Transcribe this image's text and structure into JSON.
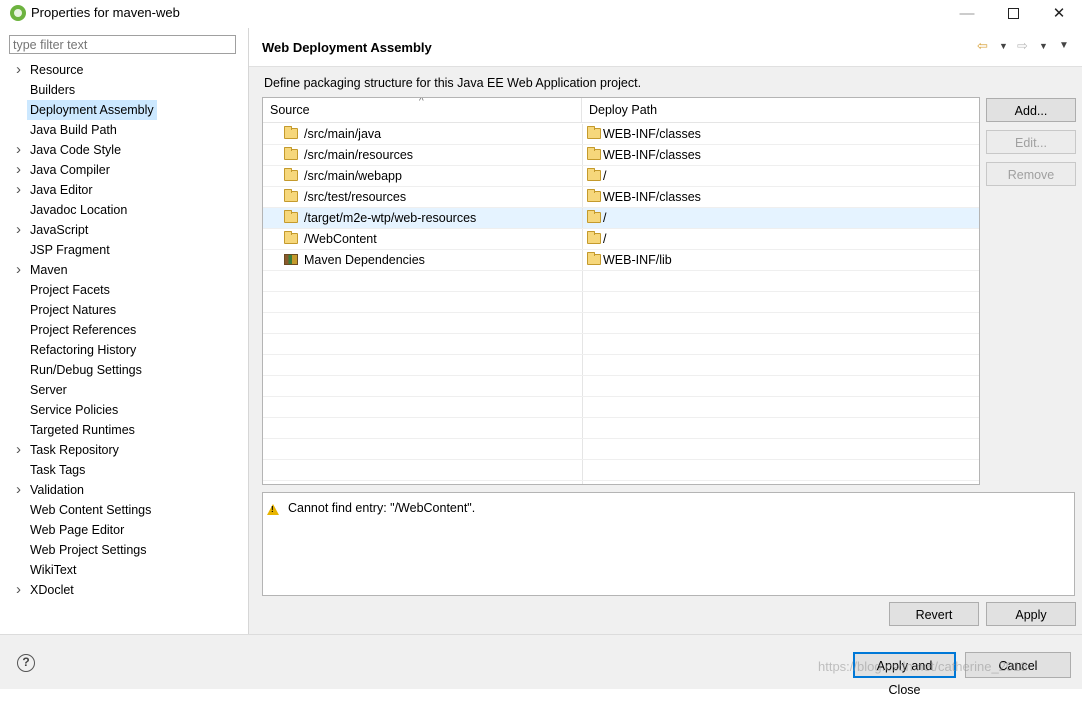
{
  "window": {
    "title": "Properties for maven-web",
    "controls": {
      "minimize": "—",
      "close": "✕"
    }
  },
  "filter": {
    "placeholder": "type filter text",
    "value": ""
  },
  "tree": [
    {
      "label": "Resource",
      "expandable": true
    },
    {
      "label": "Builders",
      "expandable": false
    },
    {
      "label": "Deployment Assembly",
      "expandable": false,
      "selected": true
    },
    {
      "label": "Java Build Path",
      "expandable": false
    },
    {
      "label": "Java Code Style",
      "expandable": true
    },
    {
      "label": "Java Compiler",
      "expandable": true
    },
    {
      "label": "Java Editor",
      "expandable": true
    },
    {
      "label": "Javadoc Location",
      "expandable": false
    },
    {
      "label": "JavaScript",
      "expandable": true
    },
    {
      "label": "JSP Fragment",
      "expandable": false
    },
    {
      "label": "Maven",
      "expandable": true
    },
    {
      "label": "Project Facets",
      "expandable": false
    },
    {
      "label": "Project Natures",
      "expandable": false
    },
    {
      "label": "Project References",
      "expandable": false
    },
    {
      "label": "Refactoring History",
      "expandable": false
    },
    {
      "label": "Run/Debug Settings",
      "expandable": false
    },
    {
      "label": "Server",
      "expandable": false
    },
    {
      "label": "Service Policies",
      "expandable": false
    },
    {
      "label": "Targeted Runtimes",
      "expandable": false
    },
    {
      "label": "Task Repository",
      "expandable": true
    },
    {
      "label": "Task Tags",
      "expandable": false
    },
    {
      "label": "Validation",
      "expandable": true
    },
    {
      "label": "Web Content Settings",
      "expandable": false
    },
    {
      "label": "Web Page Editor",
      "expandable": false
    },
    {
      "label": "Web Project Settings",
      "expandable": false
    },
    {
      "label": "WikiText",
      "expandable": false
    },
    {
      "label": "XDoclet",
      "expandable": true
    }
  ],
  "page": {
    "title": "Web Deployment Assembly",
    "description": "Define packaging structure for this Java EE Web Application project.",
    "nav": {
      "back": "⇦",
      "forward": "⇨",
      "dropdown": "▼",
      "menu": "▼"
    }
  },
  "table": {
    "columns": {
      "source": "Source",
      "deploy_path": "Deploy Path"
    },
    "sort_indicator": "^",
    "rows": [
      {
        "source": "/src/main/java",
        "deploy": "WEB-INF/classes",
        "icon": "folder-icon"
      },
      {
        "source": "/src/main/resources",
        "deploy": "WEB-INF/classes",
        "icon": "folder-icon"
      },
      {
        "source": "/src/main/webapp",
        "deploy": "/",
        "icon": "folder-icon"
      },
      {
        "source": "/src/test/resources",
        "deploy": "WEB-INF/classes",
        "icon": "folder-icon"
      },
      {
        "source": "/target/m2e-wtp/web-resources",
        "deploy": "/",
        "icon": "folder-icon",
        "selected": true
      },
      {
        "source": "/WebContent",
        "deploy": "/",
        "icon": "folder-icon"
      },
      {
        "source": "Maven Dependencies",
        "deploy": "WEB-INF/lib",
        "icon": "library-icon"
      }
    ],
    "empty_rows": 11
  },
  "buttons": {
    "add": "Add...",
    "edit": "Edit...",
    "remove": "Remove",
    "revert": "Revert",
    "apply": "Apply",
    "apply_close": "Apply and Close",
    "cancel": "Cancel",
    "help": "?"
  },
  "message": {
    "text": "Cannot find entry: \"/WebContent\".",
    "icon": "warning-icon"
  },
  "watermark": "https://blog.csdn.net/catherine_2018",
  "colors": {
    "selection": "#cce8ff",
    "row_selection": "#e5f3ff",
    "default_button_border": "#0078d7"
  }
}
